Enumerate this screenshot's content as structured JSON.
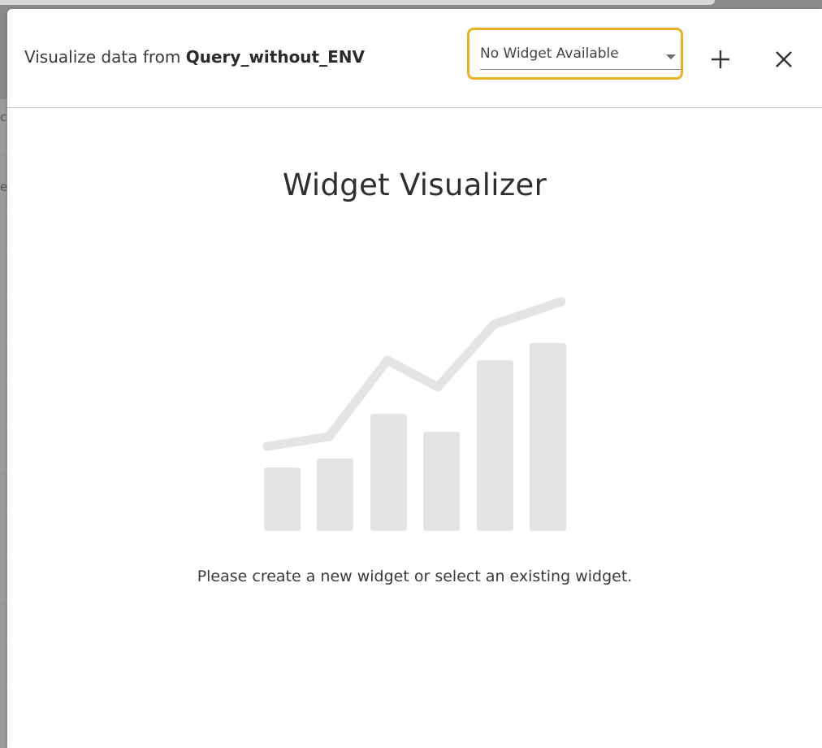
{
  "header": {
    "prefix": "Visualize data from",
    "query_name": "Query_without_ENV"
  },
  "widget_select": {
    "value": "No Widget Available",
    "focus_color": "#eab128"
  },
  "actions": {
    "add_icon": "plus-icon",
    "close_icon": "close-icon"
  },
  "main": {
    "title": "Widget Visualizer",
    "illustration_icon": "chart-placeholder-icon",
    "message": "Please create a new widget or select an existing widget."
  },
  "background_peek": {
    "letter_1": "c",
    "letter_2": "e"
  }
}
